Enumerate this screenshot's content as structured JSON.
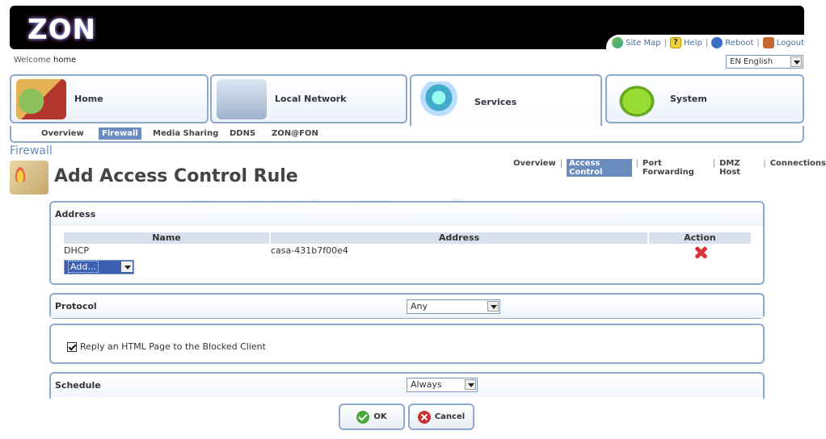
{
  "brand": {
    "logo": "ZON"
  },
  "toplinks": [
    {
      "icon": "sitemap-icon",
      "label": "Site Map"
    },
    {
      "icon": "help-icon",
      "label": "Help"
    },
    {
      "icon": "reboot-icon",
      "label": "Reboot"
    },
    {
      "icon": "logout-icon",
      "label": "Logout"
    }
  ],
  "welcome": {
    "prefix": "Welcome",
    "user": "home"
  },
  "language": {
    "selected": "EN English"
  },
  "nav": {
    "tabs": [
      {
        "label": "Home",
        "icon": "home-icon"
      },
      {
        "label": "Local Network",
        "icon": "network-icon"
      },
      {
        "label": "Services",
        "icon": "services-icon",
        "active": true
      },
      {
        "label": "System",
        "icon": "router-icon"
      }
    ]
  },
  "subnav": {
    "items": [
      "Overview",
      "Firewall",
      "Media Sharing",
      "DDNS",
      "ZON@FON"
    ],
    "active": "Firewall"
  },
  "section": {
    "name": "Firewall",
    "icon": "firewall-icon"
  },
  "page": {
    "title": "Add Access Control Rule"
  },
  "subsub": {
    "items": [
      "Overview",
      "Access Control",
      "Port Forwarding",
      "DMZ Host",
      "Connections"
    ],
    "active": "Access Control"
  },
  "watermark": "PcWinTech.com",
  "address": {
    "title": "Address",
    "columns": [
      "Name",
      "Address",
      "Action"
    ],
    "rows": [
      {
        "name": "DHCP",
        "address": "casa-431b7f00e4",
        "action": "delete-icon"
      }
    ],
    "add_select": "Add..."
  },
  "protocol": {
    "title": "Protocol",
    "selected": "Any"
  },
  "reply": {
    "label": "Reply an HTML Page to the Blocked Client",
    "checked": true
  },
  "schedule": {
    "title": "Schedule",
    "selected": "Always"
  },
  "buttons": {
    "ok": "OK",
    "cancel": "Cancel"
  },
  "colors": {
    "accent": "#6c8bbf",
    "border": "#8fa8cf",
    "delete": "#d9343a"
  }
}
